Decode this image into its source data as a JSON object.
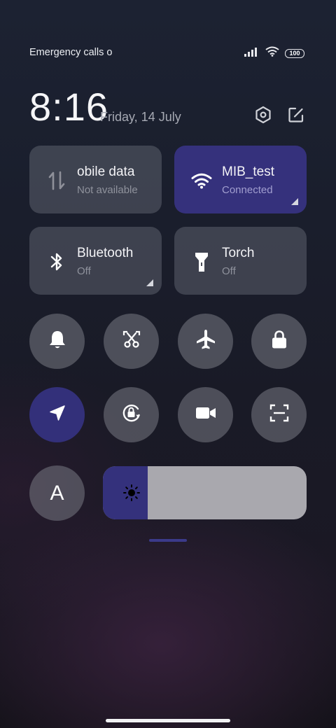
{
  "status_bar": {
    "carrier_text": "Emergency calls o",
    "battery": "100",
    "icons": [
      "signal-icon",
      "wifi-icon",
      "battery-icon"
    ]
  },
  "header": {
    "time": "8:16",
    "date": "Friday, 14 July",
    "icons": [
      "settings-hexagon-icon",
      "edit-icon"
    ]
  },
  "tiles": [
    {
      "id": "mobile-data",
      "label": "obile data",
      "sub": "Not available",
      "icon": "mobile-data-arrows-icon",
      "active": false
    },
    {
      "id": "wifi",
      "label": "MIB_test",
      "sub": "Connected",
      "icon": "wifi-icon",
      "active": true
    },
    {
      "id": "bluetooth",
      "label": "Bluetooth",
      "sub": "Off",
      "icon": "bluetooth-icon",
      "active": false
    },
    {
      "id": "torch",
      "label": "Torch",
      "sub": "Off",
      "icon": "torch-icon",
      "active": false
    }
  ],
  "toggles": [
    {
      "id": "ring",
      "icon": "bell-icon",
      "active": false
    },
    {
      "id": "screenshot",
      "icon": "scissors-screenshot-icon",
      "active": false
    },
    {
      "id": "airplane",
      "icon": "airplane-icon",
      "active": false
    },
    {
      "id": "lock",
      "icon": "lock-icon",
      "active": false
    },
    {
      "id": "location",
      "icon": "location-arrow-icon",
      "active": true
    },
    {
      "id": "rotation-lock",
      "icon": "rotation-lock-icon",
      "active": false
    },
    {
      "id": "screen-recorder",
      "icon": "video-camera-icon",
      "active": false
    },
    {
      "id": "scanner",
      "icon": "scan-icon",
      "active": false
    },
    {
      "id": "font",
      "label": "A",
      "icon": "font-a-icon",
      "active": false
    }
  ],
  "brightness": {
    "level": 0.22,
    "icon": "sun-icon"
  },
  "colors": {
    "accent": "#35317c",
    "tile_inactive": "#4a4d58",
    "slider_track": "#a9a8ae"
  }
}
